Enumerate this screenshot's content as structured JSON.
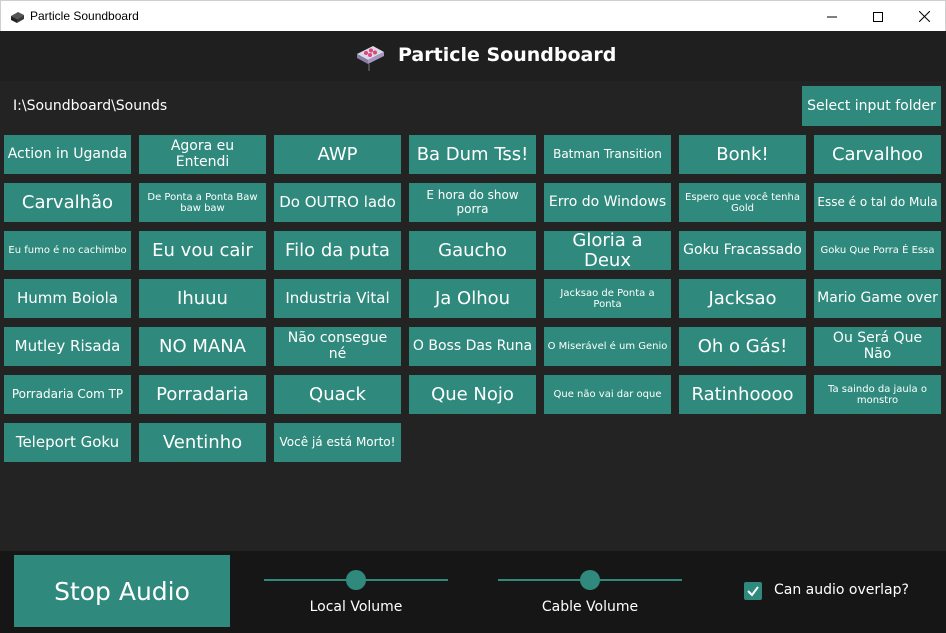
{
  "window": {
    "title": "Particle Soundboard"
  },
  "header": {
    "title": "Particle Soundboard"
  },
  "folder": {
    "path": "I:\\Soundboard\\Sounds",
    "select_label": "Select input folder"
  },
  "sounds": [
    {
      "label": "Action in Uganda",
      "size": "small"
    },
    {
      "label": "Agora eu Entendi",
      "size": "small"
    },
    {
      "label": "AWP",
      "size": "large"
    },
    {
      "label": "Ba Dum Tss!",
      "size": "large"
    },
    {
      "label": "Batman Transition",
      "size": "xsmall"
    },
    {
      "label": "Bonk!",
      "size": "large"
    },
    {
      "label": "Carvalhoo",
      "size": "large"
    },
    {
      "label": "Carvalhão",
      "size": "large"
    },
    {
      "label": "De Ponta a Ponta Baw baw baw",
      "size": "tiny"
    },
    {
      "label": "Do OUTRO lado",
      "size": "medium"
    },
    {
      "label": "E hora do show porra",
      "size": "xsmall"
    },
    {
      "label": "Erro do Windows",
      "size": "small"
    },
    {
      "label": "Espero que você tenha Gold",
      "size": "tiny"
    },
    {
      "label": "Esse é o tal do Mula",
      "size": "xsmall"
    },
    {
      "label": "Eu fumo é no cachimbo",
      "size": "tiny"
    },
    {
      "label": "Eu vou cair",
      "size": "large"
    },
    {
      "label": "Filo da puta",
      "size": "large"
    },
    {
      "label": "Gaucho",
      "size": "large"
    },
    {
      "label": "Gloria a Deux",
      "size": "large"
    },
    {
      "label": "Goku Fracassado",
      "size": "small"
    },
    {
      "label": "Goku Que Porra É Essa",
      "size": "tiny"
    },
    {
      "label": "Humm Boiola",
      "size": "medium"
    },
    {
      "label": "Ihuuu",
      "size": "large"
    },
    {
      "label": "Industria Vital",
      "size": "medium"
    },
    {
      "label": "Ja Olhou",
      "size": "large"
    },
    {
      "label": "Jacksao de Ponta a Ponta",
      "size": "tiny"
    },
    {
      "label": "Jacksao",
      "size": "large"
    },
    {
      "label": "Mario Game over",
      "size": "small"
    },
    {
      "label": "Mutley Risada",
      "size": "medium"
    },
    {
      "label": "NO MANA",
      "size": "large"
    },
    {
      "label": "Não consegue né",
      "size": "small"
    },
    {
      "label": "O Boss Das Runa",
      "size": "small"
    },
    {
      "label": "O Miserável é um Genio",
      "size": "tiny"
    },
    {
      "label": "Oh o Gás!",
      "size": "large"
    },
    {
      "label": "Ou Será Que Não",
      "size": "small"
    },
    {
      "label": "Porradaria Com TP",
      "size": "xsmall"
    },
    {
      "label": "Porradaria",
      "size": "large"
    },
    {
      "label": "Quack",
      "size": "large"
    },
    {
      "label": "Que Nojo",
      "size": "large"
    },
    {
      "label": "Que não vai dar oque",
      "size": "tiny"
    },
    {
      "label": "Ratinhoooo",
      "size": "large"
    },
    {
      "label": "Ta saindo da jaula o monstro",
      "size": "tiny"
    },
    {
      "label": "Teleport Goku",
      "size": "medium"
    },
    {
      "label": "Ventinho",
      "size": "large"
    },
    {
      "label": "Você já está Morto!",
      "size": "xsmall"
    }
  ],
  "controls": {
    "stop_label": "Stop Audio",
    "local_volume": {
      "label": "Local Volume",
      "value": 0.5
    },
    "cable_volume": {
      "label": "Cable Volume",
      "value": 0.5
    },
    "overlap": {
      "label": "Can audio overlap?",
      "checked": true
    }
  },
  "colors": {
    "accent": "#2f8a7d",
    "background": "#232323",
    "header_bg": "#1f1f1f",
    "footer_bg": "#161616"
  }
}
